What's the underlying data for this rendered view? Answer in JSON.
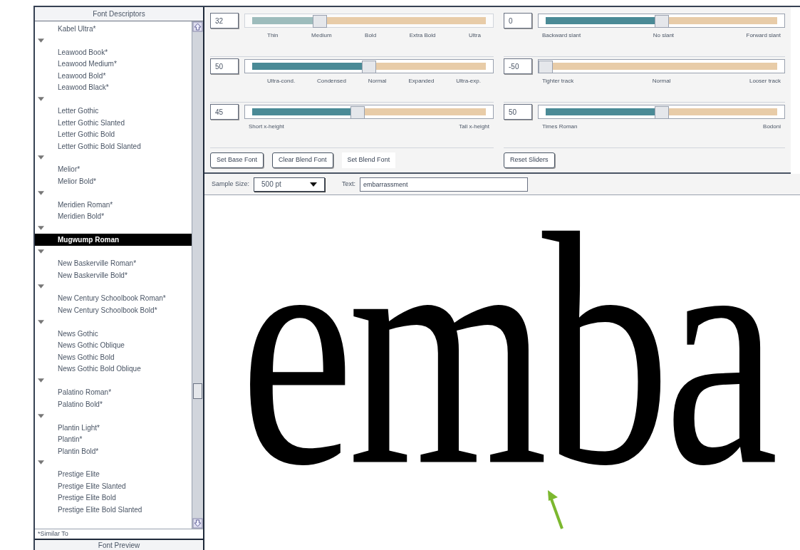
{
  "font_list": {
    "title": "Font Descriptors",
    "groups": [
      {
        "children": [
          {
            "label": "Kabel Ultra*",
            "selected": false
          }
        ]
      },
      {
        "expanded": true,
        "children": [
          {
            "label": "Leawood Book*",
            "selected": false
          },
          {
            "label": "Leawood Medium*",
            "selected": false
          },
          {
            "label": "Leawood Bold*",
            "selected": false
          },
          {
            "label": "Leawood Black*",
            "selected": false
          }
        ]
      },
      {
        "expanded": true,
        "children": [
          {
            "label": "Letter Gothic",
            "selected": false
          },
          {
            "label": "Letter Gothic Slanted",
            "selected": false
          },
          {
            "label": "Letter Gothic Bold",
            "selected": false
          },
          {
            "label": "Letter Gothic Bold Slanted",
            "selected": false
          }
        ]
      },
      {
        "expanded": true,
        "children": [
          {
            "label": "Melior*",
            "selected": false
          },
          {
            "label": "Melior Bold*",
            "selected": false
          }
        ]
      },
      {
        "expanded": true,
        "children": [
          {
            "label": "Meridien Roman*",
            "selected": false
          },
          {
            "label": "Meridien Bold*",
            "selected": false
          }
        ]
      },
      {
        "expanded": true,
        "children": [
          {
            "label": "Mugwump Roman",
            "selected": true
          }
        ]
      },
      {
        "expanded": true,
        "children": [
          {
            "label": "New Baskerville Roman*",
            "selected": false
          },
          {
            "label": "New Baskerville Bold*",
            "selected": false
          }
        ]
      },
      {
        "expanded": true,
        "children": [
          {
            "label": "New Century Schoolbook Roman*",
            "selected": false
          },
          {
            "label": "New Century Schoolbook Bold*",
            "selected": false
          }
        ]
      },
      {
        "expanded": true,
        "children": [
          {
            "label": "News Gothic",
            "selected": false
          },
          {
            "label": "News Gothic Oblique",
            "selected": false
          },
          {
            "label": "News Gothic Bold",
            "selected": false
          },
          {
            "label": "News Gothic Bold Oblique",
            "selected": false
          }
        ]
      },
      {
        "expanded": true,
        "children": [
          {
            "label": "Palatino Roman*",
            "selected": false
          },
          {
            "label": "Palatino Bold*",
            "selected": false
          }
        ]
      },
      {
        "expanded": true,
        "children": [
          {
            "label": "Plantin Light*",
            "selected": false
          },
          {
            "label": "Plantin*",
            "selected": false
          },
          {
            "label": "Plantin Bold*",
            "selected": false
          }
        ]
      },
      {
        "expanded": true,
        "children": [
          {
            "label": "Prestige Elite",
            "selected": false
          },
          {
            "label": "Prestige Elite Slanted",
            "selected": false
          },
          {
            "label": "Prestige Elite Bold",
            "selected": false
          },
          {
            "label": "Prestige Elite Bold Slanted",
            "selected": false
          }
        ]
      }
    ],
    "footnote": "*Similar To",
    "footer": "Font Preview"
  },
  "sliders": [
    {
      "value": "32",
      "level": 0.29,
      "active": false,
      "ticks": [
        "Thin",
        "Medium",
        "Bold",
        "Extra Bold",
        "Ultra"
      ]
    },
    {
      "value": "0",
      "level": 0.5,
      "active": true,
      "ticks": [
        "Backward slant",
        "No slant",
        "Forward slant"
      ]
    },
    {
      "value": "50",
      "level": 0.5,
      "active": true,
      "ticks": [
        "Ultra-cond.",
        "Condensed",
        "Normal",
        "Expanded",
        "Ultra-exp."
      ]
    },
    {
      "value": "-50",
      "level": 0,
      "active": true,
      "ticks": [
        "Tighter track",
        "Normal",
        "Looser track"
      ]
    },
    {
      "value": "45",
      "level": 0.45,
      "active": true,
      "ticks": [
        "Short x-height",
        "Tall x-height"
      ]
    },
    {
      "value": "50",
      "level": 0.5,
      "active": true,
      "ticks": [
        "Times Roman",
        "Bodoni"
      ]
    }
  ],
  "buttons_left": [
    {
      "label": "Set Base Font",
      "framed": true
    },
    {
      "label": "Clear Blend Font",
      "framed": true
    },
    {
      "label": "Set Blend Font",
      "framed": false
    }
  ],
  "buttons_right": [
    {
      "label": "Reset Sliders",
      "framed": true
    }
  ],
  "sample_bar": {
    "size_label": "Sample Size:",
    "size_value": "500 pt",
    "text_label": "Text:",
    "text_value": "embarrassment"
  },
  "preview_text": "emba"
}
